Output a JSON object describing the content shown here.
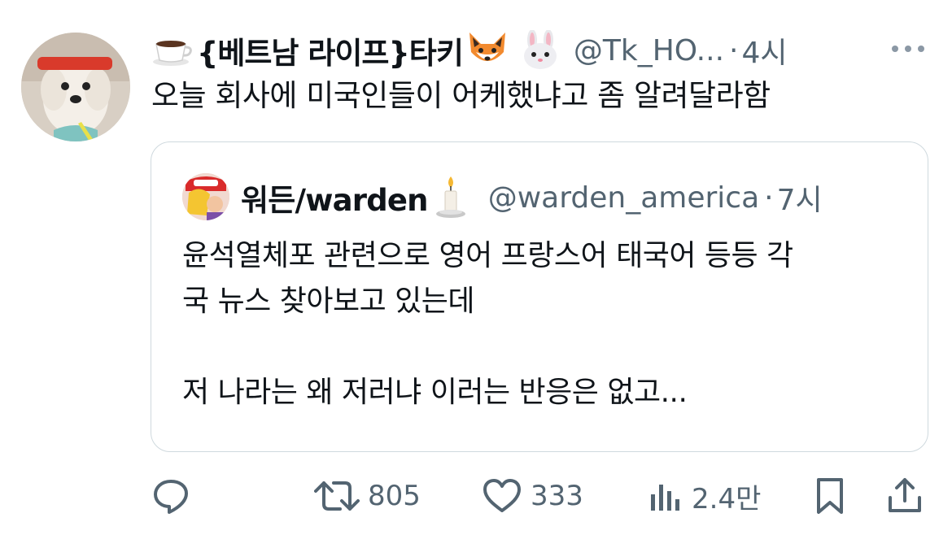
{
  "tweet": {
    "author_prefix_emoji": "coffee-cup-emoji",
    "display_name": "{베트남 라이프}타키",
    "name_emojis": [
      "fox-emoji",
      "rabbit-emoji"
    ],
    "handle": "@Tk_HO...",
    "separator": "·",
    "time": "4시",
    "text": "오늘 회사에 미국인들이 어케했냐고 좀 알려달라함"
  },
  "quote": {
    "display_name": "워든/warden",
    "name_emoji": "candle-emoji",
    "handle": "@warden_america",
    "separator": "·",
    "time": "7시",
    "text": "윤석열체포 관련으로 영어 프랑스어 태국어 등등 각\n국 뉴스 찾아보고 있는데\n\n저 나라는 왜 저러냐 이러는 반응은 없고..."
  },
  "actions": {
    "reply_icon": "reply-icon",
    "retweet_icon": "retweet-icon",
    "retweet_count": "805",
    "like_icon": "heart-icon",
    "like_count": "333",
    "views_icon": "views-icon",
    "views_count": "2.4만",
    "bookmark_icon": "bookmark-icon",
    "share_icon": "share-icon"
  },
  "colors": {
    "text_primary": "#0f1419",
    "text_secondary": "#536471",
    "border": "#cfd9de"
  }
}
